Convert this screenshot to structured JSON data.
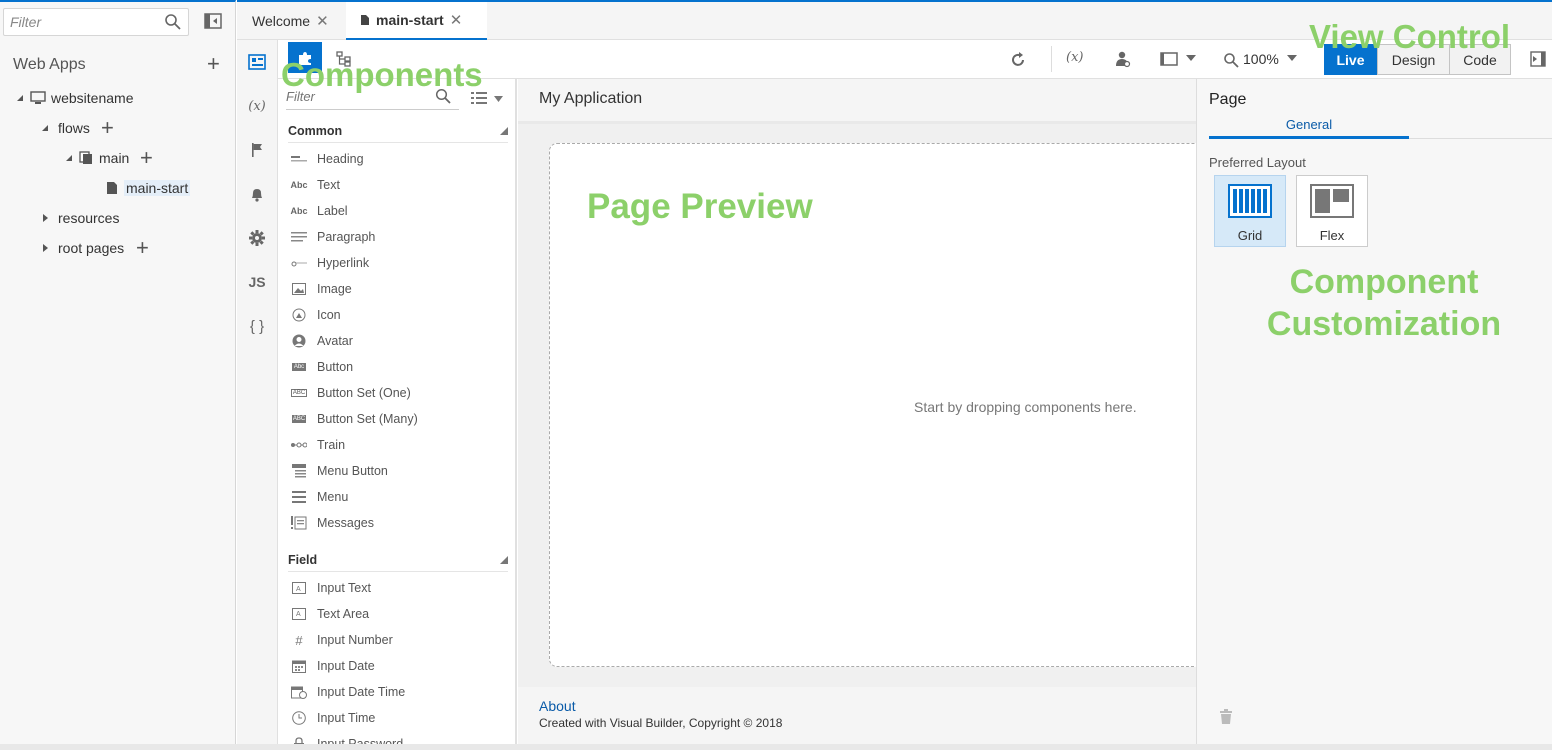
{
  "navigator": {
    "filter_placeholder": "Filter",
    "section_title": "Web Apps",
    "tree": {
      "app": "websitename",
      "flows": "flows",
      "main": "main",
      "main_start": "main-start",
      "resources": "resources",
      "root_pages": "root pages"
    }
  },
  "tabs": [
    {
      "label": "Welcome"
    },
    {
      "label": "main-start"
    }
  ],
  "toolbar": {
    "zoom": "100%",
    "view_modes": [
      "Live",
      "Design",
      "Code"
    ]
  },
  "rail": {
    "variables_glyph": "(x)",
    "js_glyph": "JS",
    "json_glyph": "{ }"
  },
  "palette": {
    "filter_placeholder": "Filter",
    "common_title": "Common",
    "common_items": [
      "Heading",
      "Text",
      "Label",
      "Paragraph",
      "Hyperlink",
      "Image",
      "Icon",
      "Avatar",
      "Button",
      "Button Set (One)",
      "Button Set (Many)",
      "Train",
      "Menu Button",
      "Menu",
      "Messages"
    ],
    "field_title": "Field",
    "field_items": [
      "Input Text",
      "Text Area",
      "Input Number",
      "Input Date",
      "Input Date Time",
      "Input Time",
      "Input Password"
    ]
  },
  "canvas": {
    "app_title": "My Application",
    "drop_hint": "Start by dropping components here.",
    "footer_link": "About",
    "footer_text": "Created with Visual Builder, Copyright © 2018"
  },
  "properties": {
    "title": "Page",
    "tab": "General",
    "preferred_layout_label": "Preferred Layout",
    "layouts": [
      "Grid",
      "Flex"
    ]
  },
  "annotations": {
    "components": "Components",
    "view_control": "View Control",
    "page_preview": "Page Preview",
    "component_customization_1": "Component",
    "component_customization_2": "Customization"
  },
  "colors": {
    "accent": "#0572ce",
    "annotation": "#8cd06a"
  }
}
